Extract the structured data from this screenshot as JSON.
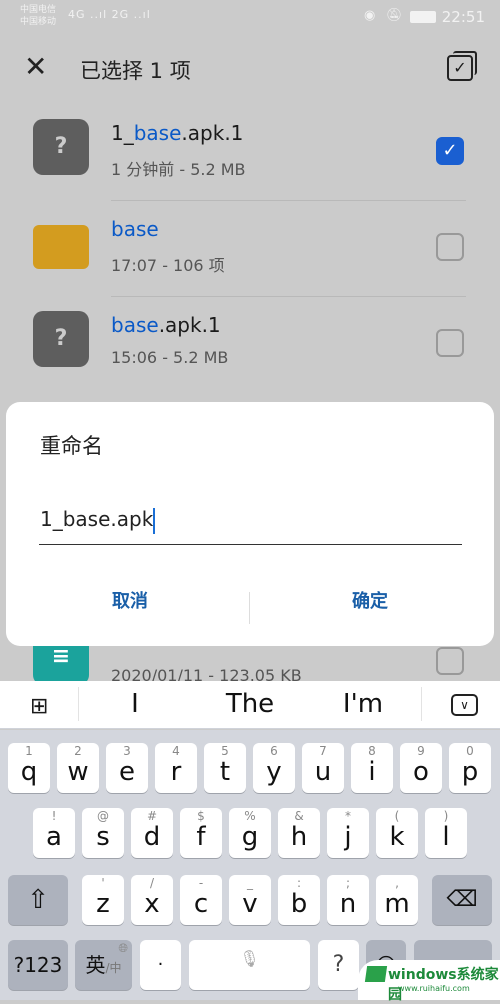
{
  "status_bar": {
    "carrier1": "中国电信",
    "carrier2": "中国移动",
    "signal": "4G ..ıl 2G ..ıl",
    "time": "22:51"
  },
  "header": {
    "title": "已选择 1 项",
    "close_icon": "close-icon",
    "select_all_icon": "select-all-icon"
  },
  "files": [
    {
      "pre": "1_",
      "hl": "base",
      "post": ".apk.1",
      "meta": "1 分钟前 - 5.2 MB",
      "type": "unknown",
      "checked": true
    },
    {
      "pre": "",
      "hl": "base",
      "post": "",
      "meta": "17:07 - 106 项",
      "type": "folder",
      "checked": false
    },
    {
      "pre": "",
      "hl": "base",
      "post": ".apk.1",
      "meta": "15:06 - 5.2 MB",
      "type": "unknown",
      "checked": false
    },
    {
      "pre": "",
      "hl": "",
      "post": "",
      "meta": "2020/01/11 - 123.05 KB",
      "type": "document",
      "checked": false
    }
  ],
  "dialog": {
    "title": "重命名",
    "value": "1_base.apk",
    "cancel": "取消",
    "confirm": "确定"
  },
  "suggestions": [
    "I",
    "The",
    "I'm"
  ],
  "keyboard": {
    "row1": [
      [
        "1",
        "q"
      ],
      [
        "2",
        "w"
      ],
      [
        "3",
        "e"
      ],
      [
        "4",
        "r"
      ],
      [
        "5",
        "t"
      ],
      [
        "6",
        "y"
      ],
      [
        "7",
        "u"
      ],
      [
        "8",
        "i"
      ],
      [
        "9",
        "o"
      ],
      [
        "0",
        "p"
      ]
    ],
    "row2": [
      [
        "!",
        "a"
      ],
      [
        "@",
        "s"
      ],
      [
        "#",
        "d"
      ],
      [
        "$",
        "f"
      ],
      [
        "%",
        "g"
      ],
      [
        "&",
        "h"
      ],
      [
        "*",
        "j"
      ],
      [
        "(",
        "k"
      ],
      [
        ")",
        "l"
      ]
    ],
    "row3": [
      [
        "'",
        "z"
      ],
      [
        "/",
        "x"
      ],
      [
        "-",
        "c"
      ],
      [
        "_",
        "v"
      ],
      [
        ":",
        "b"
      ],
      [
        ";",
        "n"
      ],
      [
        ",",
        "m"
      ]
    ],
    "numbers": "?123",
    "lang": "英",
    "lang_alt": "/中",
    "dot": "·",
    "question": "?"
  },
  "watermark": {
    "text": "windows系统家园",
    "url": "www.ruihaifu.com"
  },
  "colors": {
    "accent": "#1a5fd1",
    "highlight": "#0a59c7",
    "folder": "#d39c1f",
    "doc": "#1ba39c"
  }
}
